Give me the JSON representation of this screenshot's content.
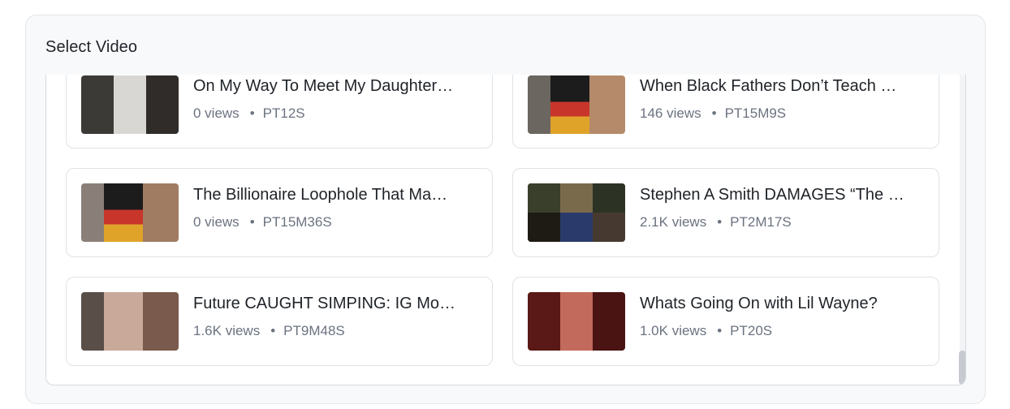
{
  "panel": {
    "title": "Select Video"
  },
  "videos": [
    {
      "title": "On My Way To Meet My Daughter…",
      "views": "0 views",
      "duration": "PT12S"
    },
    {
      "title": "When Black Fathers Don’t Teach …",
      "views": "146 views",
      "duration": "PT15M9S"
    },
    {
      "title": "The Billionaire Loophole That Ma…",
      "views": "0 views",
      "duration": "PT15M36S"
    },
    {
      "title": "Stephen A Smith DAMAGES “The …",
      "views": "2.1K views",
      "duration": "PT2M17S"
    },
    {
      "title": "Future CAUGHT SIMPING: IG Mo…",
      "views": "1.6K views",
      "duration": "PT9M48S"
    },
    {
      "title": "Whats Going On with Lil Wayne?",
      "views": "1.0K views",
      "duration": "PT20S"
    }
  ],
  "separator": "•",
  "colors": {
    "panel_bg": "#f8f9fb",
    "card_border": "#dfe2e6",
    "text": "#1f2328",
    "meta": "#6b7280"
  }
}
